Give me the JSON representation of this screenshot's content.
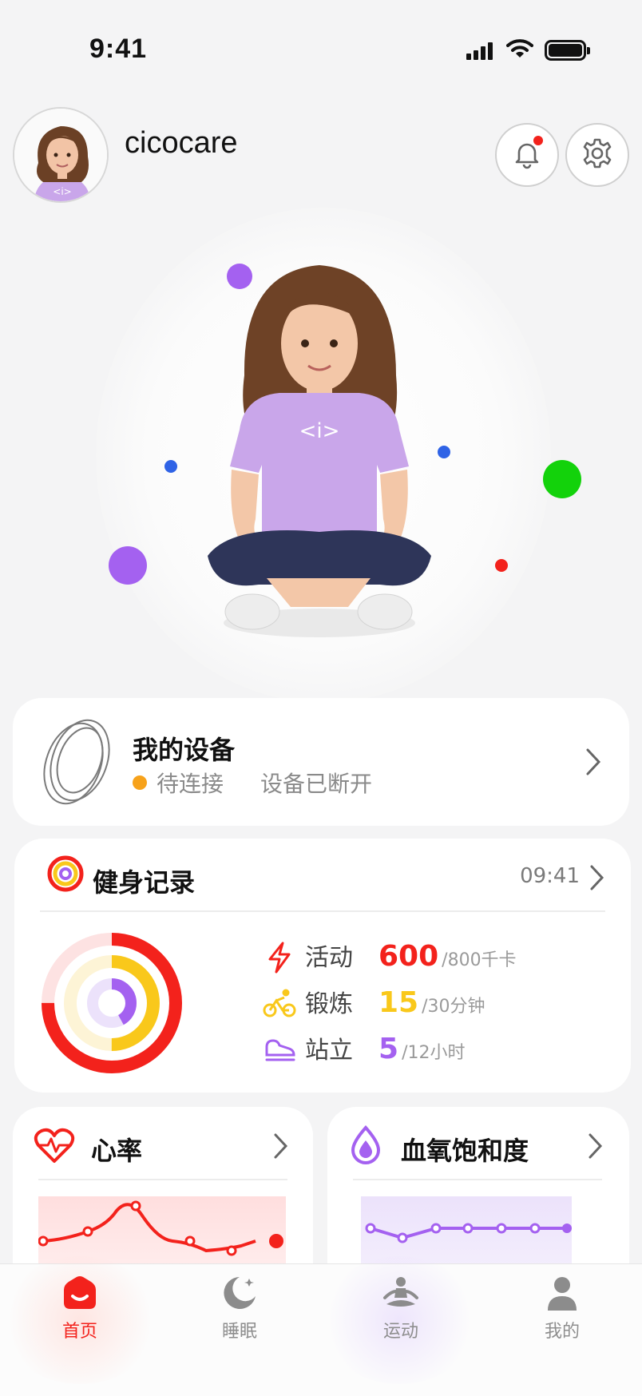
{
  "status_bar": {
    "time": "9:41"
  },
  "header": {
    "username": "cicocare"
  },
  "device": {
    "title": "我的设备",
    "status": "待连接",
    "substatus": "设备已断开"
  },
  "fitness": {
    "title": "健身记录",
    "time": "09:41",
    "metrics": [
      {
        "label": "活动",
        "value": "600",
        "unit": "/800千卡",
        "color": "#f3221c",
        "progress": 0.75
      },
      {
        "label": "锻炼",
        "value": "15",
        "unit": "/30分钟",
        "color": "#f9c81b",
        "progress": 0.5
      },
      {
        "label": "站立",
        "value": "5",
        "unit": "/12小时",
        "color": "#a461f0",
        "progress": 0.42
      }
    ]
  },
  "heart_rate": {
    "title": "心率",
    "color": "#f3221c"
  },
  "spo2": {
    "title": "血氧饱和度",
    "color": "#a461f0"
  },
  "tabs": [
    {
      "label": "首页",
      "icon": "home-icon",
      "active": true
    },
    {
      "label": "睡眠",
      "icon": "moon-icon",
      "active": false
    },
    {
      "label": "运动",
      "icon": "meditation-icon",
      "active": false
    },
    {
      "label": "我的",
      "icon": "person-icon",
      "active": false
    }
  ]
}
